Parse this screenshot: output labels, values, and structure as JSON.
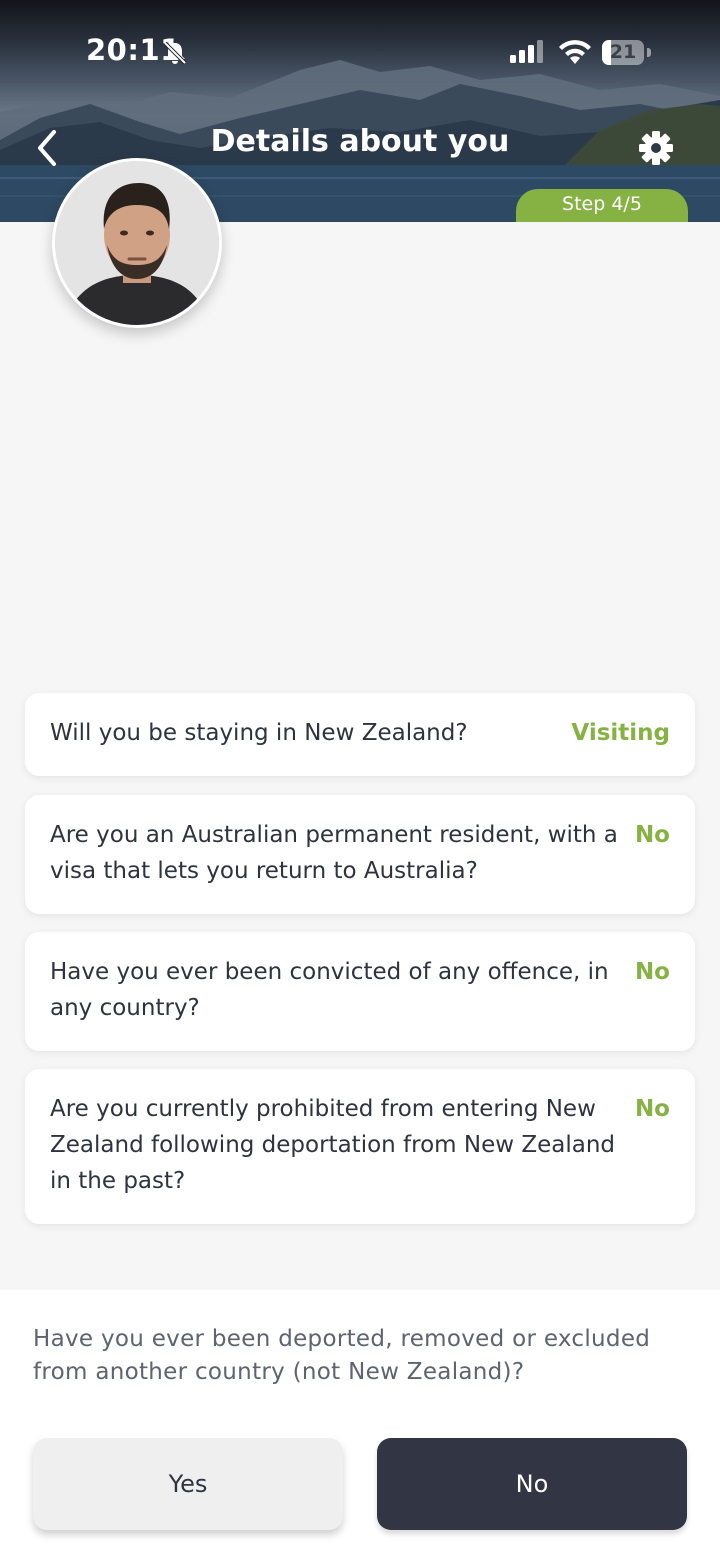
{
  "status_bar": {
    "time": "20:11",
    "battery": "21"
  },
  "header": {
    "title": "Details about you",
    "step": "Step 4/5"
  },
  "questions": [
    {
      "question": "Will you be staying in New Zealand?",
      "answer": "Visiting"
    },
    {
      "question": "Are you an Australian permanent resident, with a visa that lets you return to Australia?",
      "answer": "No"
    },
    {
      "question": "Have you ever been convicted of any offence, in any country?",
      "answer": "No"
    },
    {
      "question": "Are you currently prohibited from entering New Zealand following deportation from New Zealand in the past?",
      "answer": "No"
    }
  ],
  "current_question": {
    "prompt": "Have you ever been deported, removed or excluded from another country (not New Zealand)?",
    "yes_label": "Yes",
    "no_label": "No"
  },
  "colors": {
    "accent": "#86b243",
    "dark_button": "#323644"
  },
  "icons": [
    "bell-slash-icon",
    "cellular-signal-icon",
    "wifi-icon",
    "battery-icon",
    "back-chevron-icon",
    "gear-icon"
  ]
}
